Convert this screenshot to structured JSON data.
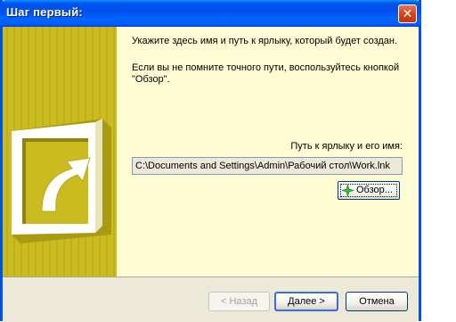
{
  "window": {
    "title": "Шаг первый:"
  },
  "titlebar": {
    "close_glyph": "✕"
  },
  "instructions": {
    "para1": "Укажите здесь имя и путь к ярлыку, который будет создан.",
    "para2": "Если вы не помните точного пути, воспользуйтесь кнопкой \"Обзор\"."
  },
  "path": {
    "label": "Путь к ярлыку и его имя:",
    "value": "C:\\Documents and Settings\\Admin\\Рабочий стол\\Work.lnk"
  },
  "browse": {
    "label": "Обзор..."
  },
  "footer": {
    "back_label": "< Назад",
    "next_label": "Далее >",
    "cancel_label": "Отмена"
  },
  "colors": {
    "titlebar": "#0054e3",
    "content_bg": "#fffbd5",
    "sidebar": "#c9bb20",
    "footer_bg": "#ece9d8"
  },
  "icons": {
    "sidebar_graphic": "shortcut-arrow-icon",
    "browse": "browse-star-icon",
    "close": "close-icon"
  }
}
